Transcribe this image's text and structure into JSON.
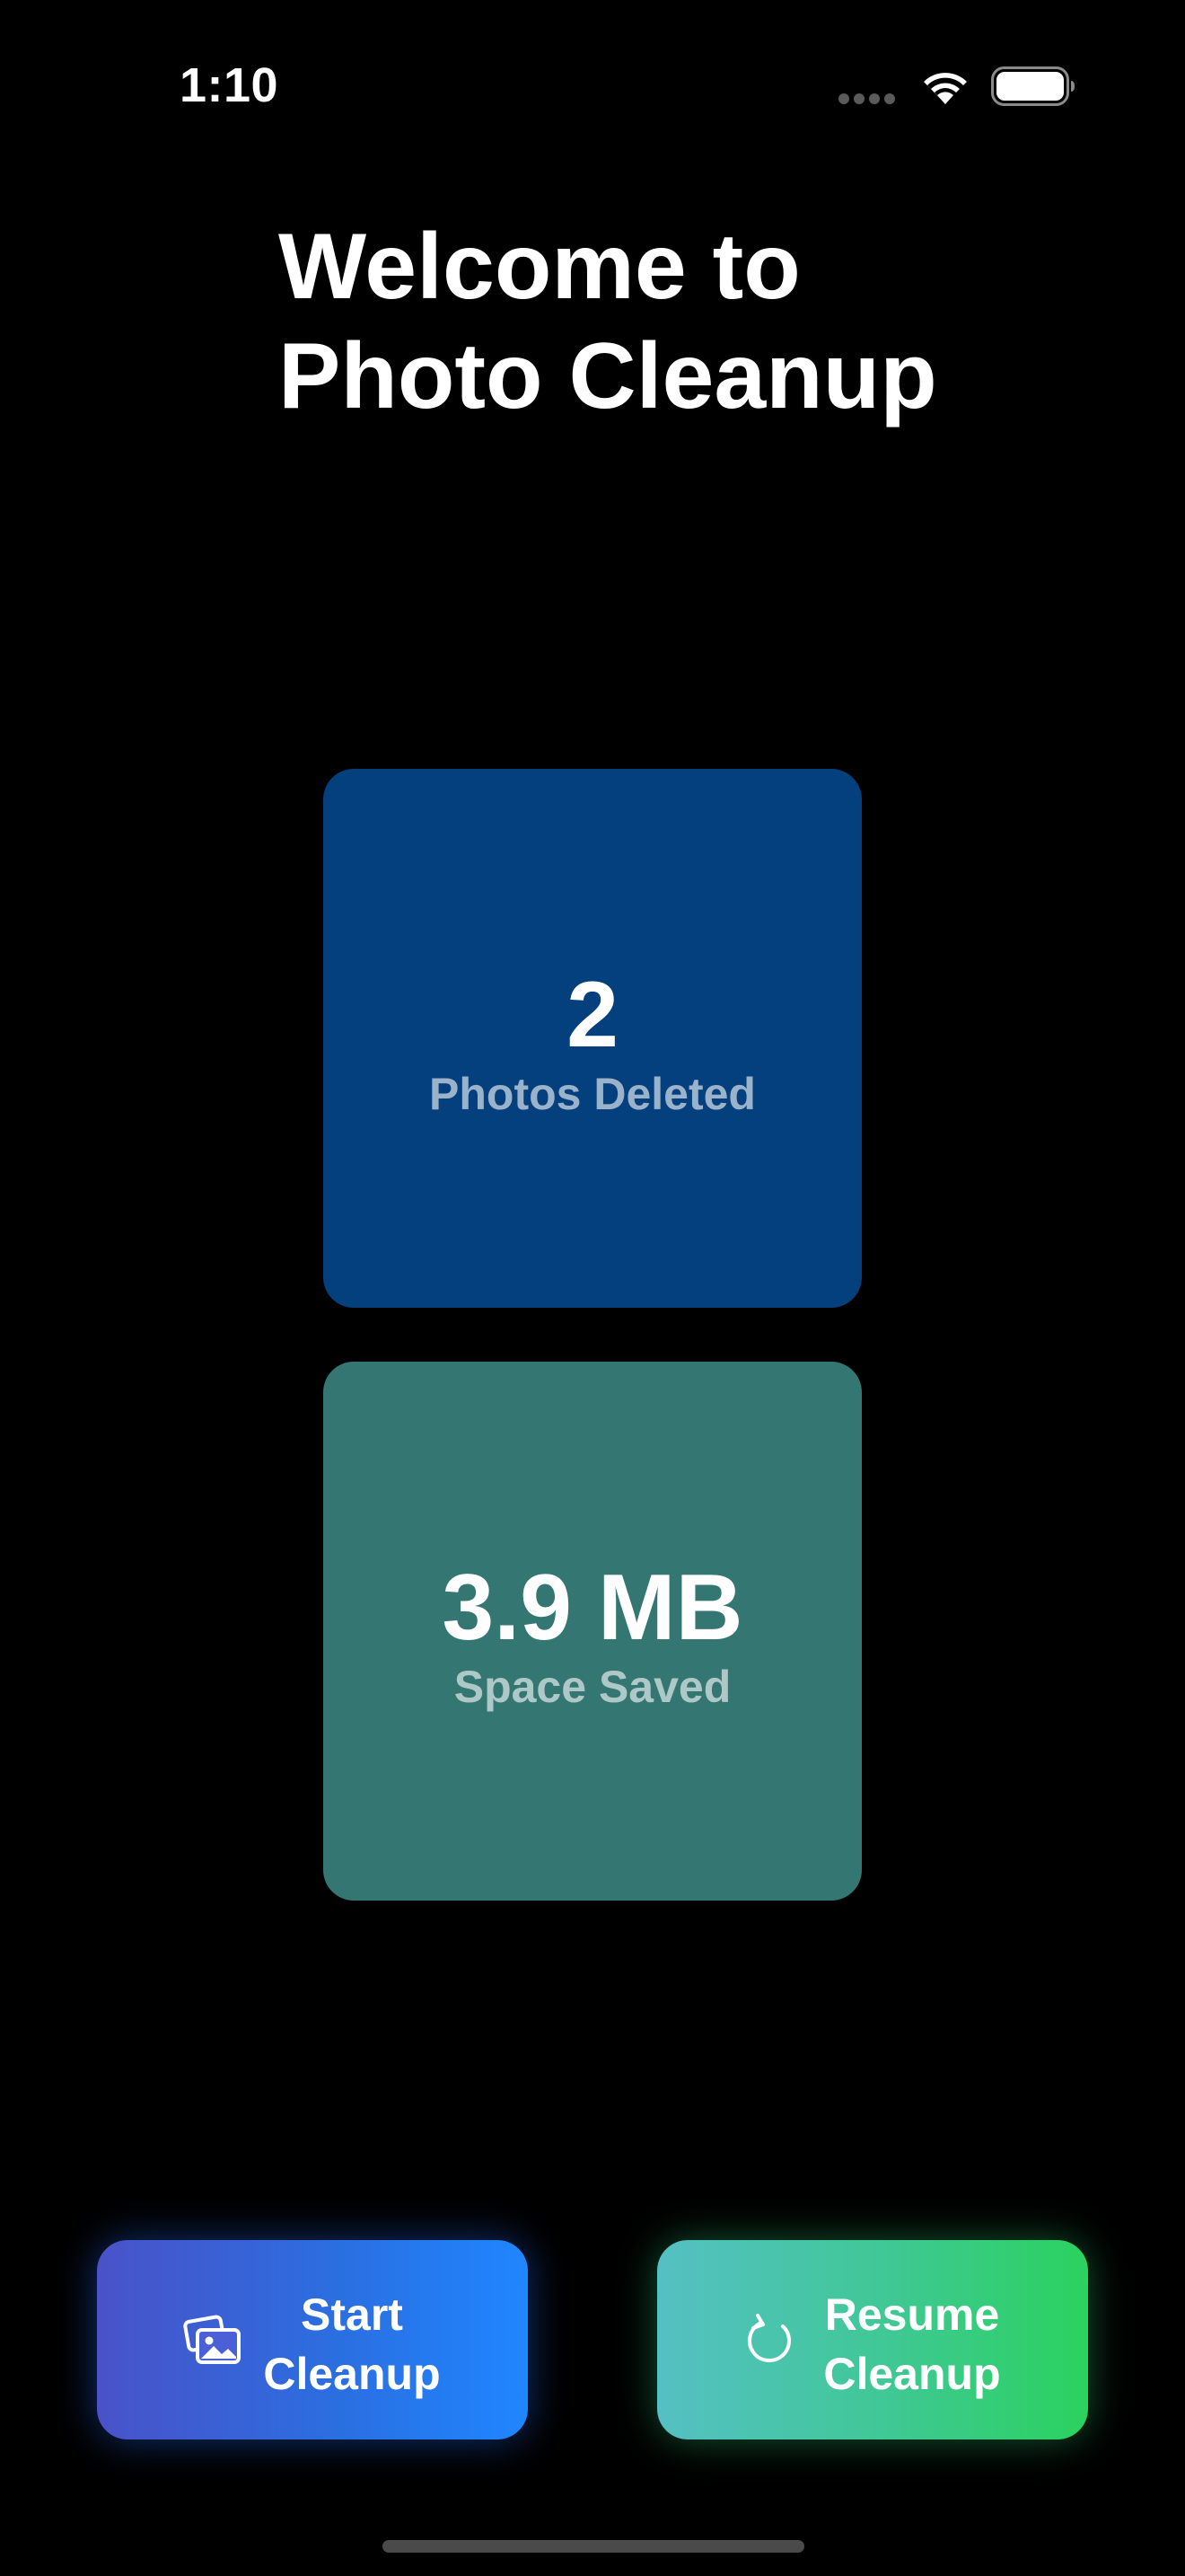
{
  "status_bar": {
    "time": "1:10",
    "icons": [
      "cellular-dots-icon",
      "wifi-icon",
      "battery-icon"
    ]
  },
  "header": {
    "title_line1": "Welcome to",
    "title_line2": "Photo Cleanup"
  },
  "stats": {
    "deleted": {
      "value": "2",
      "label": "Photos Deleted",
      "color": "#05407e"
    },
    "saved": {
      "value": "3.9 MB",
      "label": "Space Saved",
      "color": "#337672"
    }
  },
  "actions": {
    "start": {
      "line1": "Start",
      "line2": "Cleanup",
      "icon": "photos-icon"
    },
    "resume": {
      "line1": "Resume",
      "line2": "Cleanup",
      "icon": "refresh-icon"
    }
  },
  "colors": {
    "background": "#000000",
    "start_gradient": [
      "#4a52c8",
      "#1f86ff"
    ],
    "resume_gradient": [
      "#55c0c4",
      "#2ad25e"
    ]
  }
}
